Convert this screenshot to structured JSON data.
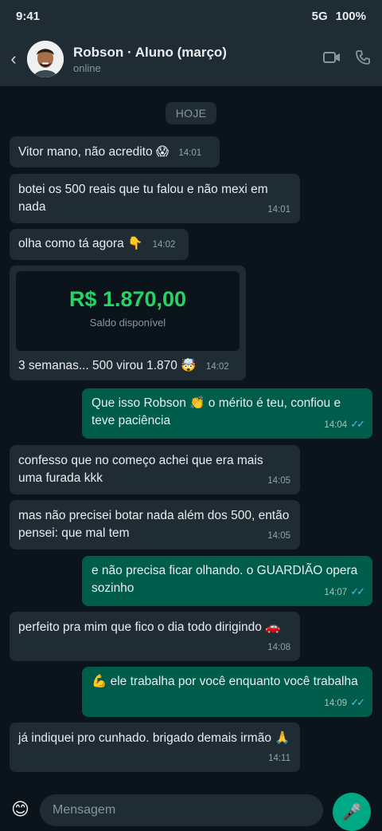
{
  "status_bar": {
    "time": "9:41",
    "network": "5G",
    "battery": "100%"
  },
  "header": {
    "back_icon": "chevron-left-icon",
    "contact_name": "Robson · Aluno (março)",
    "contact_status": "online",
    "icons": [
      "video-icon",
      "phone-icon"
    ]
  },
  "chat": {
    "date_label": "HOJE",
    "messages": [
      {
        "dir": "in",
        "text": "Vitor mano, não acredito 😱",
        "time": "14:01"
      },
      {
        "dir": "in",
        "text": "botei os 500 reais que tu falou e não mexi em nada",
        "time": "14:01"
      },
      {
        "dir": "in",
        "text": "olha como tá agora 👇",
        "time": "14:02"
      },
      {
        "dir": "in",
        "card_amount": "R$ 1.870,00",
        "card_label": "Saldo disponível",
        "text": "3 semanas... 500 virou 1.870 🤯",
        "time": "14:02"
      },
      {
        "dir": "out",
        "text": "Que isso Robson 👏 o mérito é teu, confiou e teve paciência",
        "time": "14:04",
        "ticks": "✓✓"
      },
      {
        "dir": "in",
        "text": "confesso que no começo achei que era mais uma furada kkk",
        "time": "14:05"
      },
      {
        "dir": "in",
        "text": "mas não precisei botar nada além dos 500, então pensei: que mal tem",
        "time": "14:05"
      },
      {
        "dir": "out",
        "text": "e não precisa ficar olhando. o GUARDIÃO opera sozinho",
        "time": "14:07",
        "ticks": "✓✓"
      },
      {
        "dir": "in",
        "text": "perfeito pra mim que fico o dia todo dirigindo 🚗",
        "time": "14:08"
      },
      {
        "dir": "out",
        "text": "💪 ele trabalha por você enquanto você trabalha",
        "time": "14:09",
        "ticks": "✓✓"
      },
      {
        "dir": "in",
        "text": "já indiquei pro cunhado. brigado demais irmão 🙏",
        "time": "14:11"
      }
    ]
  },
  "composer": {
    "placeholder": "Mensagem",
    "emoji_icon": "smiley-icon",
    "mic_icon": "microphone-icon"
  },
  "colors": {
    "bg": "#0b141a",
    "incoming": "#202c33",
    "outgoing": "#005c4b",
    "accent": "#00a884",
    "amount": "#25d366"
  }
}
